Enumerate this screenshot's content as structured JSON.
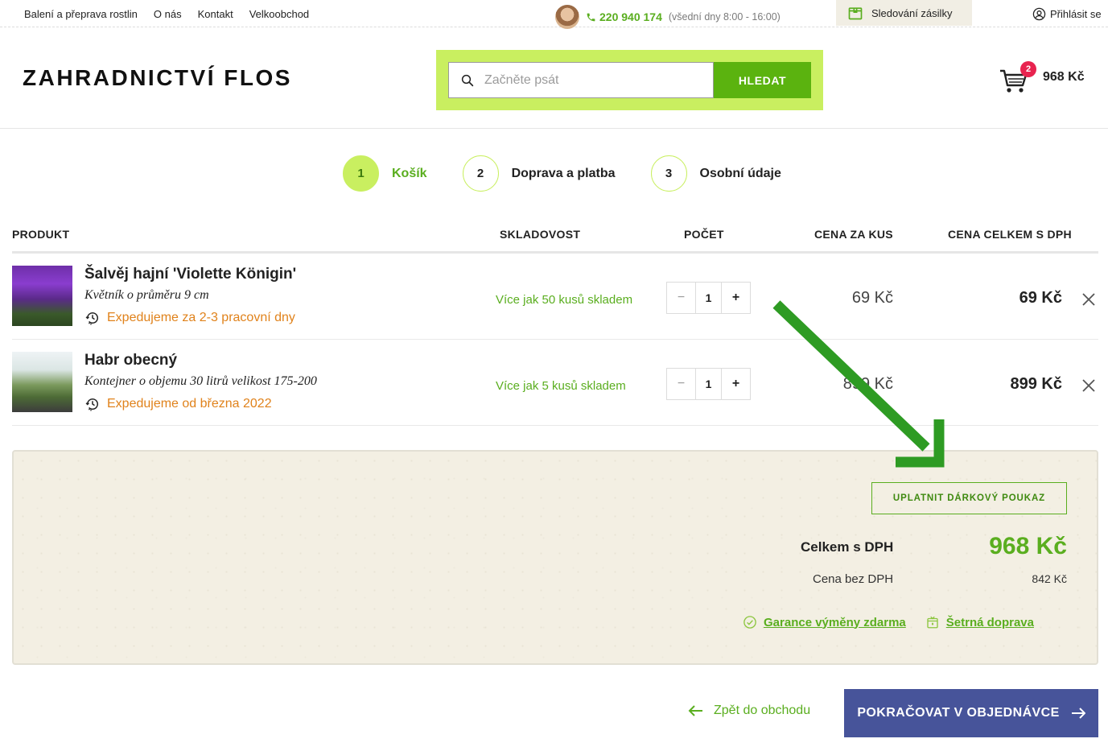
{
  "topbar": {
    "nav": [
      "Balení a přeprava rostlin",
      "O nás",
      "Kontakt",
      "Velkoobchod"
    ],
    "phone": "220 940 174",
    "phone_hours": "(všední dny 8:00 - 16:00)",
    "tracking": "Sledování zásilky",
    "login": "Přihlásit se"
  },
  "header": {
    "logo": "ZAHRADNICTVÍ FLOS",
    "search_placeholder": "Začněte psát",
    "search_button": "HLEDAT",
    "cart_count": "2",
    "cart_total": "968 Kč"
  },
  "steps": [
    {
      "num": "1",
      "label": "Košík",
      "active": true
    },
    {
      "num": "2",
      "label": "Doprava a platba",
      "active": false
    },
    {
      "num": "3",
      "label": "Osobní údaje",
      "active": false
    }
  ],
  "table": {
    "headers": [
      "PRODUKT",
      "SKLADOVOST",
      "POČET",
      "CENA ZA KUS",
      "CENA CELKEM S DPH"
    ],
    "rows": [
      {
        "name": "Šalvěj hajní 'Violette Königin'",
        "variant": "Květník o průměru 9 cm",
        "shipping": "Expedujeme za 2-3 pracovní dny",
        "stock": "Více jak 50 kusů skladem",
        "qty": "1",
        "unit_price": "69 Kč",
        "total": "69 Kč"
      },
      {
        "name": "Habr obecný",
        "variant": "Kontejner o objemu 30 litrů velikost 175-200",
        "shipping": "Expedujeme od března 2022",
        "stock": "Více jak 5 kusů skladem",
        "qty": "1",
        "unit_price": "899 Kč",
        "total": "899 Kč"
      }
    ]
  },
  "summary": {
    "voucher": "UPLATNIT DÁRKOVÝ POUKAZ",
    "total_label": "Celkem s DPH",
    "total": "968 Kč",
    "novat_label": "Cena bez DPH",
    "novat": "842 Kč",
    "guarantee": "Garance výměny zdarma",
    "eco_shipping": "Šetrná doprava"
  },
  "actions": {
    "back": "Zpět do obchodu",
    "continue": "POKRAČOVAT V OBJEDNÁVCE"
  },
  "colors": {
    "accent_green": "#5aae1f",
    "lime": "#c9ef60",
    "shipping_orange": "#e0821b",
    "primary_blue": "#47549a",
    "badge_red": "#e8234f",
    "annotation_arrow": "#2e9b23"
  }
}
